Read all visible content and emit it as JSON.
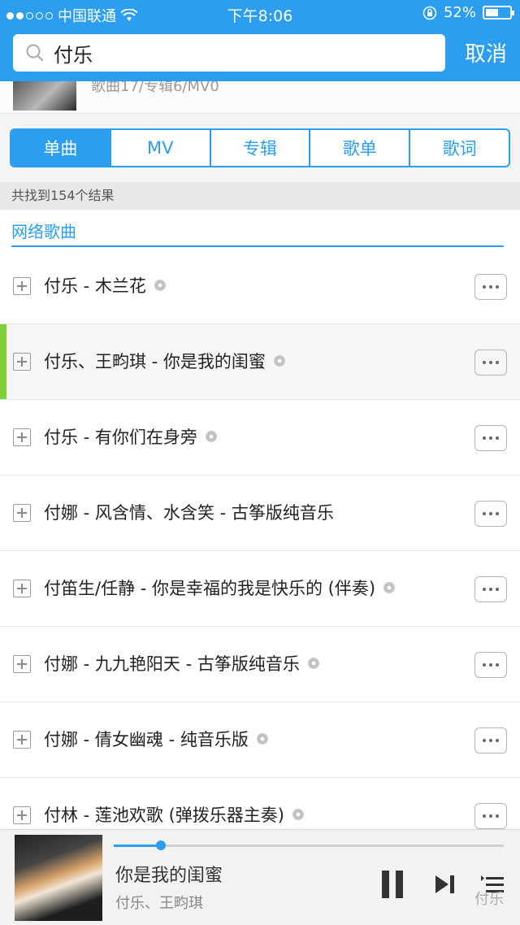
{
  "status": {
    "carrier": "中国联通",
    "time": "下午8:06",
    "battery": "52%",
    "battery_level": 0.52
  },
  "search": {
    "query": "付乐",
    "cancel": "取消"
  },
  "artist": {
    "meta": "歌曲17/专辑6/MV0"
  },
  "tabs": [
    "单曲",
    "MV",
    "专辑",
    "歌单",
    "歌词"
  ],
  "results_count": "共找到154个结果",
  "section_label": "网络歌曲",
  "songs": [
    "付乐 - 木兰花",
    "付乐、王畇琪 - 你是我的闺蜜",
    "付乐 - 有你们在身旁",
    "付娜 - 风含情、水含笑 - 古筝版纯音乐",
    "付笛生/任静 - 你是幸福的我是快乐的 (伴奏)",
    "付娜 - 九九艳阳天 - 古筝版纯音乐",
    "付娜 - 倩女幽魂 - 纯音乐版",
    "付林 - 莲池欢歌 (弹拨乐器主奏)"
  ],
  "player": {
    "song": "你是我的闺蜜",
    "artist": "付乐、王畇琪",
    "progress": 0.12
  },
  "watermark": "付乐",
  "colors": {
    "accent": "#2b9ef0",
    "playing_marker": "#7fd13b"
  }
}
